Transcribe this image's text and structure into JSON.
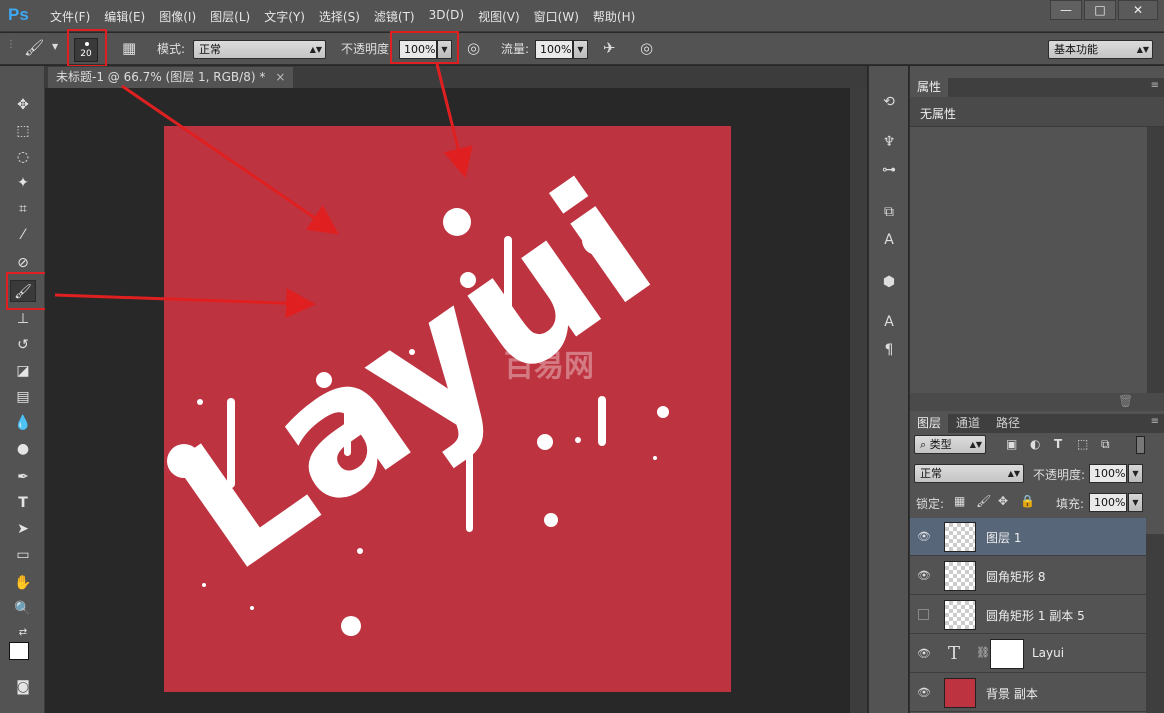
{
  "app": {
    "logo": "Ps"
  },
  "menu": [
    "文件(F)",
    "编辑(E)",
    "图像(I)",
    "图层(L)",
    "文字(Y)",
    "选择(S)",
    "滤镜(T)",
    "3D(D)",
    "视图(V)",
    "窗口(W)",
    "帮助(H)"
  ],
  "window_buttons": {
    "minimize": "—",
    "restore": "□",
    "close": "✕"
  },
  "options": {
    "brush_size": "20",
    "mode_label": "模式:",
    "mode_value": "正常",
    "opacity_label": "不透明度:",
    "opacity_value": "100%",
    "flow_label": "流量:",
    "flow_value": "100%",
    "workspace": "基本功能"
  },
  "document": {
    "tab_title": "未标题-1 @ 66.7% (图层 1, RGB/8) *",
    "close": "×"
  },
  "canvas": {
    "background_color": "#bd3340",
    "artwork_text": "Layui",
    "watermark": "百易网"
  },
  "properties": {
    "tab": "属性",
    "content": "无属性"
  },
  "layers_panel": {
    "tabs": [
      "图层",
      "通道",
      "路径"
    ],
    "filter_kind": "类型",
    "blend_mode": "正常",
    "opacity_label": "不透明度:",
    "opacity_value": "100%",
    "lock_label": "锁定:",
    "fill_label": "填充:",
    "fill_value": "100%",
    "layers": [
      {
        "name": "图层 1",
        "selected": true,
        "visible": true,
        "type": "pixel"
      },
      {
        "name": "圆角矩形 8",
        "selected": false,
        "visible": true,
        "type": "shape"
      },
      {
        "name": "圆角矩形 1 副本 5",
        "selected": false,
        "visible": false,
        "type": "shape"
      },
      {
        "name": "Layui",
        "selected": false,
        "visible": true,
        "type": "text"
      },
      {
        "name": "背景 副本",
        "selected": false,
        "visible": true,
        "type": "fill"
      }
    ]
  },
  "colors": {
    "accent_red": "#e02020",
    "canvas_red": "#bd3340",
    "selected_layer": "#58667a"
  }
}
